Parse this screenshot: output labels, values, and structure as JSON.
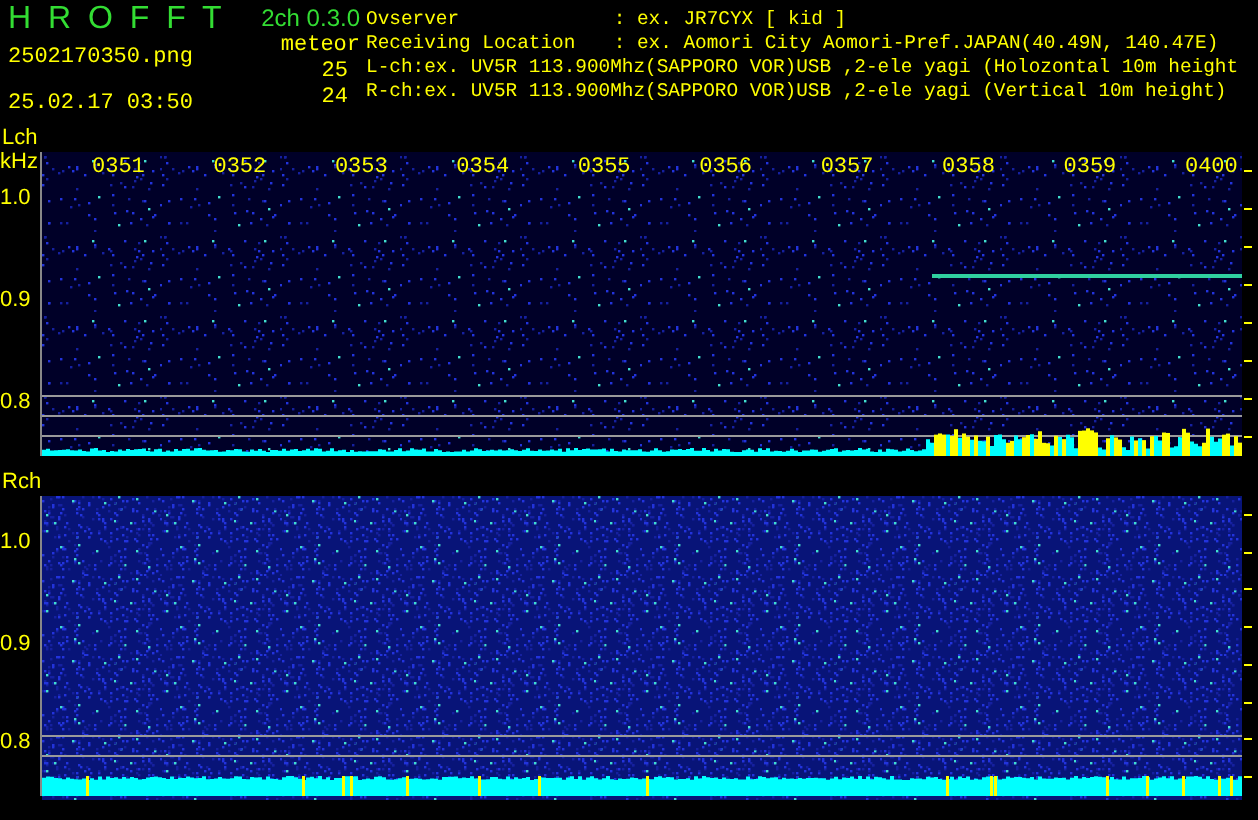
{
  "header": {
    "title": "H R O F F T",
    "version": "2ch 0.3.0",
    "filename": "2502170350.png",
    "timestamp": "25.02.17 03:50",
    "meteor_label": "meteor",
    "counts": [
      "25",
      "24"
    ]
  },
  "info": [
    {
      "label": "Ovserver",
      "value": ": ex. JR7CYX [ kid ]"
    },
    {
      "label": "Receiving Location",
      "value": ": ex. Aomori City Aomori-Pref.JAPAN(40.49N, 140.47E)"
    }
  ],
  "channels_info": [
    "L-ch:ex. UV5R 113.900Mhz(SAPPORO VOR)USB ,2-ele yagi (Holozontal 10m height",
    "R-ch:ex. UV5R 113.900Mhz(SAPPORO VOR)USB ,2-ele yagi (Vertical 10m height)"
  ],
  "panels": [
    {
      "channel": "Lch",
      "unit": "kHz",
      "yticks": [
        "1.0",
        "0.9",
        "0.8"
      ],
      "times": [
        "0351",
        "0352",
        "0353",
        "0354",
        "0355",
        "0356",
        "0357",
        "0358",
        "0359",
        "0400"
      ]
    },
    {
      "channel": "Rch",
      "yticks": [
        "1.0",
        "0.9",
        "0.8"
      ]
    }
  ]
}
